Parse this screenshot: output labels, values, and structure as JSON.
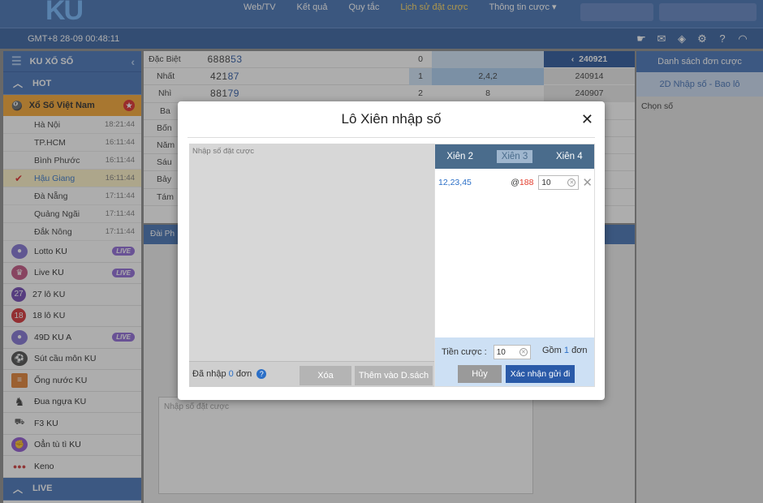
{
  "brand": {
    "logo": "KU"
  },
  "nav": [
    "Web/TV",
    "Kết quả",
    "Quy tắc",
    "Lịch sử đặt cược",
    "Thông tin cược"
  ],
  "clock": "GMT+8 28-09 00:48:11",
  "sidebar": {
    "title": "KU XỔ SỐ",
    "hot": "HOT",
    "vn": "Xổ Số Việt Nam",
    "cities": [
      {
        "name": "Hà Nội",
        "time": "18:21:44"
      },
      {
        "name": "TP.HCM",
        "time": "16:11:44"
      },
      {
        "name": "Bình Phước",
        "time": "16:11:44"
      },
      {
        "name": "Hậu Giang",
        "time": "16:11:44"
      },
      {
        "name": "Đà Nẵng",
        "time": "17:11:44"
      },
      {
        "name": "Quảng Ngãi",
        "time": "17:11:44"
      },
      {
        "name": "Đắk Nông",
        "time": "17:11:44"
      }
    ],
    "items": [
      {
        "name": "Lotto KU",
        "live": "LIVE"
      },
      {
        "name": "Live KU",
        "live": "LIVE"
      },
      {
        "name": "27 lô KU",
        "icon": "27"
      },
      {
        "name": "18 lô KU",
        "icon": "18"
      },
      {
        "name": "49D KU A",
        "live": "LIVE"
      },
      {
        "name": "Sút cầu môn KU"
      },
      {
        "name": "Ống nước KU"
      },
      {
        "name": "Đua ngựa KU"
      },
      {
        "name": "F3 KU"
      },
      {
        "name": "Oẳn tù tì KU"
      },
      {
        "name": "Keno"
      }
    ],
    "live_section": "LIVE"
  },
  "results": [
    {
      "label": "Đặc Biệt",
      "pre": "6888",
      "hi": "53"
    },
    {
      "label": "Nhất",
      "pre": "421",
      "hi": "87"
    },
    {
      "label": "Nhì",
      "pre": "881",
      "hi": "79"
    },
    {
      "label": "Ba"
    },
    {
      "label": "Bốn"
    },
    {
      "label": "Năm"
    },
    {
      "label": "Sáu"
    },
    {
      "label": "Bảy"
    },
    {
      "label": "Tám"
    }
  ],
  "col2": [
    "0",
    "1",
    "2"
  ],
  "col3": [
    "",
    "2,4,2",
    "8"
  ],
  "col4": {
    "head": "240921",
    "rows": [
      "240914",
      "240907"
    ]
  },
  "right_panel": {
    "head": "Danh sách đơn cược",
    "sub": "2D Nhập số - Bao lô",
    "label": "Chọn số"
  },
  "lower": {
    "tab": "Đài Ph",
    "ta_ph": "Nhập số đặt cược"
  },
  "modal": {
    "title": "Lô Xiên nhập số",
    "left_ph": "Nhập số đặt cược",
    "count_prefix": "Đã nhập",
    "count": "0",
    "count_suffix": "đơn",
    "btn_clear": "Xóa",
    "btn_add": "Thêm vào D.sách",
    "tabs": [
      "Xiên 2",
      "Xiên 3",
      "Xiên 4"
    ],
    "bet": {
      "nums": "12,23,45",
      "at": "@",
      "odds": "188",
      "amount": "10"
    },
    "stake_label": "Tiền cược :",
    "stake": "10",
    "gom": "Gồm",
    "gom_n": "1",
    "gom_s": "đơn",
    "btn_cancel": "Hủy",
    "btn_confirm": "Xác nhận gửi đi"
  }
}
